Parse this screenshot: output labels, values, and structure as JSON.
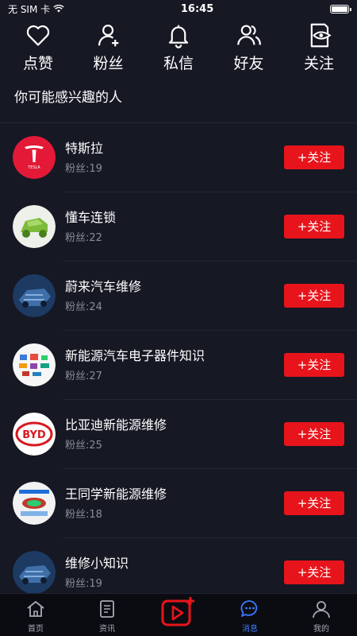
{
  "status_bar": {
    "carrier": "无 SIM 卡",
    "time": "16:45"
  },
  "actions": [
    {
      "label": "点赞",
      "icon": "heart-icon"
    },
    {
      "label": "粉丝",
      "icon": "user-add-icon"
    },
    {
      "label": "私信",
      "icon": "bell-icon"
    },
    {
      "label": "好友",
      "icon": "friends-icon"
    },
    {
      "label": "关注",
      "icon": "eye-note-icon"
    }
  ],
  "section_title": "你可能感兴趣的人",
  "suggestions": [
    {
      "name": "特斯拉",
      "fans": "粉丝:19",
      "button": "+关注",
      "avatar_text": "TESLA"
    },
    {
      "name": "懂车连锁",
      "fans": "粉丝:22",
      "button": "+关注"
    },
    {
      "name": "蔚来汽车维修",
      "fans": "粉丝:24",
      "button": "+关注"
    },
    {
      "name": "新能源汽车电子器件知识",
      "fans": "粉丝:27",
      "button": "+关注"
    },
    {
      "name": "比亚迪新能源维修",
      "fans": "粉丝:25",
      "button": "+关注",
      "avatar_text": "BYD"
    },
    {
      "name": "王同学新能源维修",
      "fans": "粉丝:18",
      "button": "+关注"
    },
    {
      "name": "维修小知识",
      "fans": "粉丝:19",
      "button": "+关注"
    }
  ],
  "tabbar": [
    {
      "label": "首页",
      "icon": "home-icon"
    },
    {
      "label": "资讯",
      "icon": "news-icon"
    },
    {
      "label": "",
      "icon": "video-publish-icon"
    },
    {
      "label": "消息",
      "icon": "message-icon",
      "active": true
    },
    {
      "label": "我的",
      "icon": "profile-icon"
    }
  ],
  "colors": {
    "background": "#161824",
    "accent_red": "#e8141b",
    "active_blue": "#3d7bff"
  }
}
